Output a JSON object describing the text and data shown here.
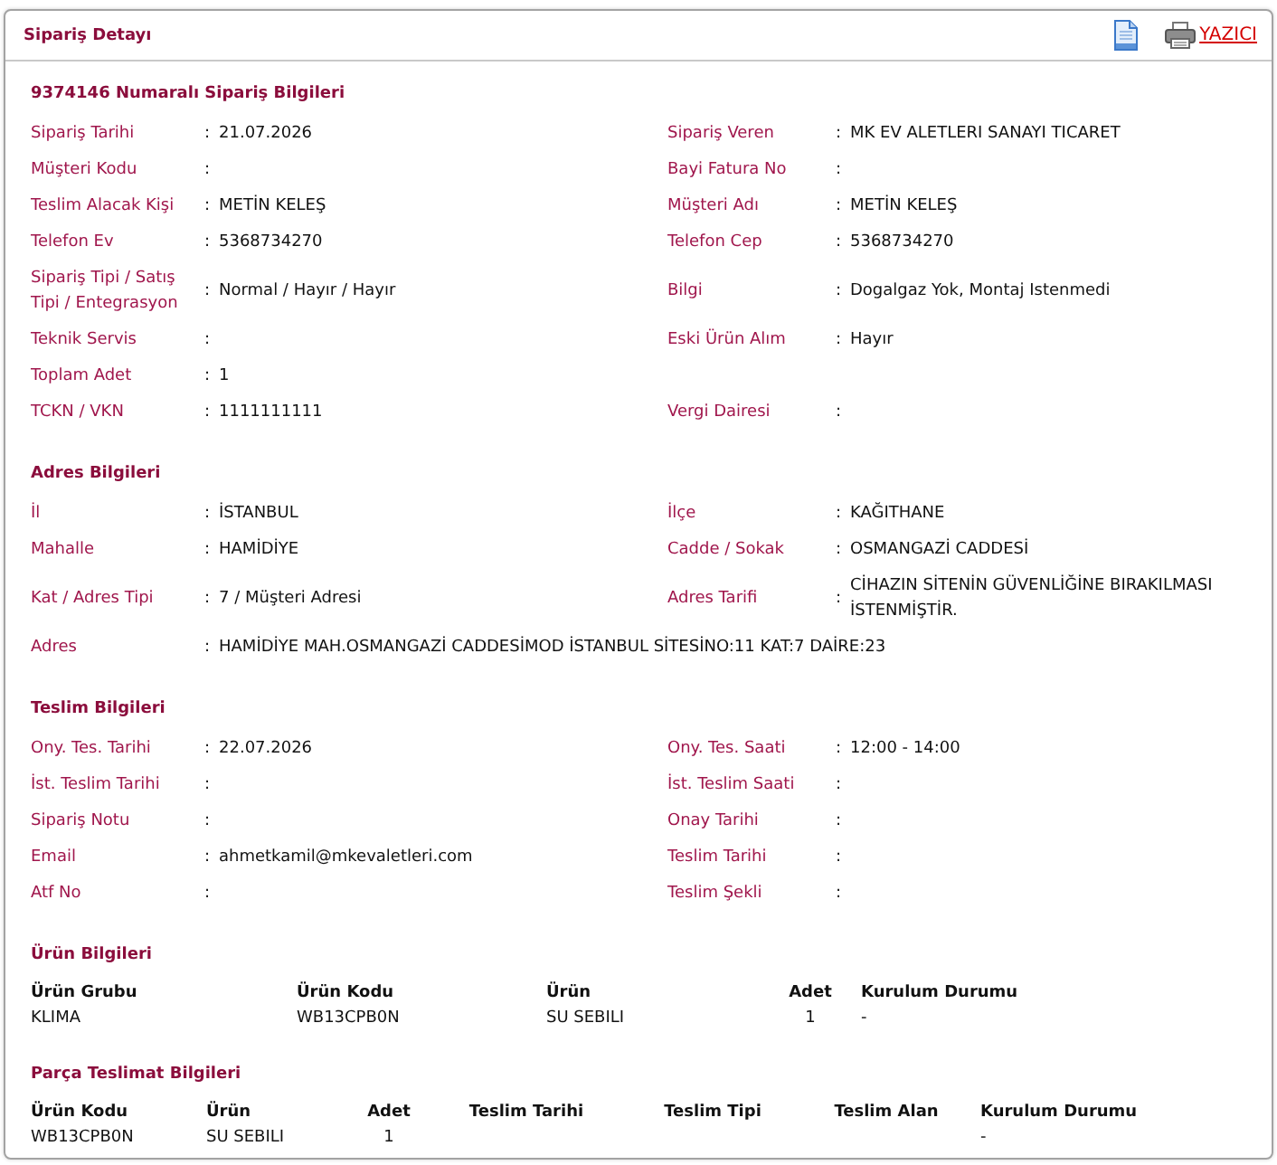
{
  "panel": {
    "title": "Sipariş Detayı",
    "print_link": {
      "label": "YAZICI"
    }
  },
  "sections": [
    {
      "kind": "fields",
      "title": "9374146 Numaralı Sipariş Bilgileri",
      "rows": [
        {
          "left": {
            "label": "Sipariş Tarihi",
            "separator": ":",
            "value": "21.07.2026"
          },
          "right": {
            "label": "Sipariş Veren",
            "separator": ":",
            "value": "MK EV ALETLERI SANAYI TICARET"
          }
        },
        {
          "left": {
            "label": "Müşteri Kodu",
            "separator": ":"
          },
          "right": {
            "label": "Bayi Fatura No",
            "separator": ":"
          }
        },
        {
          "left": {
            "label": "Teslim Alacak Kişi",
            "separator": ":",
            "value": "METİN KELEŞ"
          },
          "right": {
            "label": "Müşteri Adı",
            "separator": ":",
            "value": "METİN KELEŞ"
          }
        },
        {
          "left": {
            "label": "Telefon Ev",
            "separator": ":",
            "value": "5368734270"
          },
          "right": {
            "label": "Telefon Cep",
            "separator": ":",
            "value": "5368734270"
          }
        },
        {
          "left": {
            "label": "Sipariş Tipi / Satış Tipi / Entegrasyon",
            "separator": ":",
            "value": "Normal / Hayır / Hayır"
          },
          "right": {
            "label": "Bilgi",
            "separator": ":",
            "value": "Dogalgaz Yok, Montaj Istenmedi"
          }
        },
        {
          "left": {
            "label": "Teknik Servis",
            "separator": ":"
          },
          "right": {
            "label": "Eski Ürün Alım",
            "separator": ":",
            "value": "Hayır"
          }
        },
        {
          "left": {
            "label": "Toplam Adet",
            "separator": ":",
            "value": "1"
          }
        },
        {
          "left": {
            "label": "TCKN / VKN",
            "separator": ":",
            "value": "1111111111"
          },
          "right": {
            "label": "Vergi Dairesi",
            "separator": ":"
          }
        }
      ]
    },
    {
      "kind": "fields",
      "title": "Adres Bilgileri",
      "rows": [
        {
          "left": {
            "label": "İl",
            "separator": ":",
            "value": "İSTANBUL"
          },
          "right": {
            "label": "İlçe",
            "separator": ":",
            "value": "KAĞITHANE"
          }
        },
        {
          "left": {
            "label": "Mahalle",
            "separator": ":",
            "value": "HAMİDİYE"
          },
          "right": {
            "label": "Cadde / Sokak",
            "separator": ":",
            "value": "OSMANGAZİ CADDESİ"
          }
        },
        {
          "left": {
            "label": "Kat / Adres Tipi",
            "separator": ":",
            "value": "7 / Müşteri Adresi"
          },
          "right": {
            "label": "Adres Tarifi",
            "separator": ":",
            "value": "CİHAZIN SİTENİN GÜVENLİĞİNE BIRAKILMASI İSTENMİŞTİR."
          }
        },
        {
          "left": {
            "label": "Adres",
            "separator": ":",
            "value": "HAMİDİYE MAH.OSMANGAZİ CADDESİMOD İSTANBUL SİTESİNO:11 KAT:7 DAİRE:23"
          }
        }
      ]
    },
    {
      "kind": "fields",
      "title": "Teslim Bilgileri",
      "rows": [
        {
          "left": {
            "label": "Ony. Tes. Tarihi",
            "separator": ":",
            "value": "22.07.2026"
          },
          "right": {
            "label": "Ony. Tes. Saati",
            "separator": ":",
            "value": "12:00 - 14:00"
          }
        },
        {
          "left": {
            "label": "İst. Teslim Tarihi",
            "separator": ":"
          },
          "right": {
            "label": "İst. Teslim Saati",
            "separator": ":"
          }
        },
        {
          "left": {
            "label": "Sipariş Notu",
            "separator": ":"
          },
          "right": {
            "label": "Onay Tarihi",
            "separator": ":"
          }
        },
        {
          "left": {
            "label": "Email",
            "separator": ":",
            "value": "ahmetkamil@mkevaletleri.com"
          },
          "right": {
            "label": "Teslim Tarihi",
            "separator": ":"
          }
        },
        {
          "left": {
            "label": "Atf No",
            "separator": ":"
          },
          "right": {
            "label": "Teslim Şekli",
            "separator": ":"
          }
        }
      ]
    },
    {
      "kind": "table",
      "title": "Ürün Bilgileri",
      "columns": [
        "Ürün Grubu",
        "Ürün Kodu",
        "Ürün",
        "Adet",
        "Kurulum Durumu"
      ],
      "rows": [
        [
          "KLIMA",
          "WB13CPB0N",
          "SU SEBILI",
          "1",
          "-"
        ]
      ]
    },
    {
      "kind": "table",
      "title": "Parça Teslimat Bilgileri",
      "columns": [
        "Ürün Kodu",
        "Ürün",
        "Adet",
        "Teslim Tarihi",
        "Teslim Tipi",
        "Teslim Alan",
        "Kurulum Durumu"
      ],
      "rows": [
        [
          "WB13CPB0N",
          "SU SEBILI",
          "1",
          null,
          null,
          null,
          "-"
        ]
      ]
    }
  ]
}
